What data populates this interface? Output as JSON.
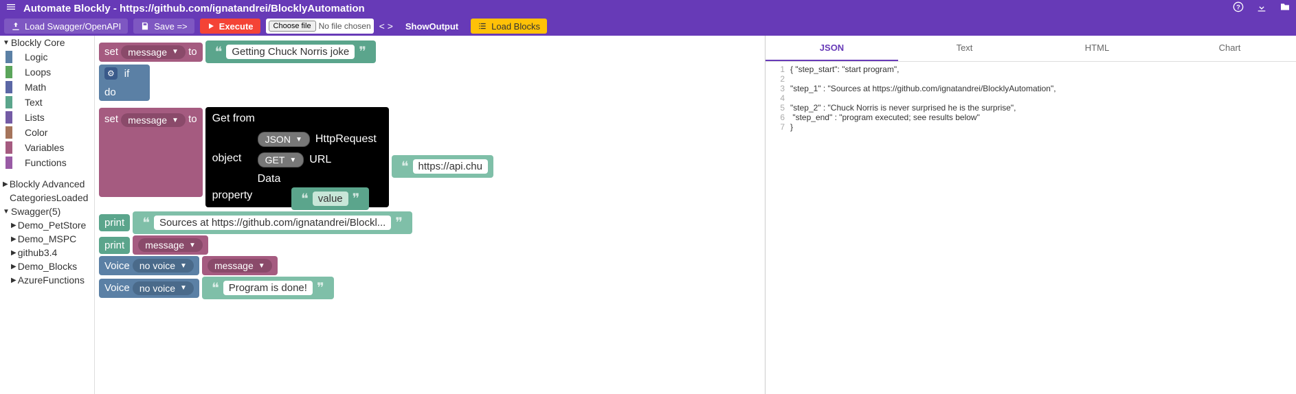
{
  "header": {
    "title": "Automate Blockly - https://github.com/ignatandrei/BlocklyAutomation"
  },
  "toolbar": {
    "load_swagger": "Load Swagger/OpenAPI",
    "save": "Save =>",
    "execute": "Execute",
    "choose_file": "Choose file",
    "no_file": "No file chosen",
    "show_output": "ShowOutput",
    "load_blocks": "Load Blocks"
  },
  "sidebar": {
    "core_label": "Blockly Core",
    "core": [
      {
        "label": "Logic",
        "color": "#5b80a5"
      },
      {
        "label": "Loops",
        "color": "#5ba55b"
      },
      {
        "label": "Math",
        "color": "#5b67a5"
      },
      {
        "label": "Text",
        "color": "#5ba58c"
      },
      {
        "label": "Lists",
        "color": "#745ba5"
      },
      {
        "label": "Color",
        "color": "#a5745b"
      },
      {
        "label": "Variables",
        "color": "#a55b80"
      },
      {
        "label": "Functions",
        "color": "#995ba5"
      }
    ],
    "advanced_label": "Blockly Advanced",
    "categories_label": "CategoriesLoaded",
    "swagger_label": "Swagger(5)",
    "swagger": [
      "Demo_PetStore",
      "Demo_MSPC",
      "github3.4",
      "Demo_Blocks",
      "AzureFunctions"
    ]
  },
  "blocks": {
    "set": "set",
    "to": "to",
    "message": "message",
    "if": "if",
    "do": "do",
    "text1": "Getting Chuck Norris joke",
    "getfrom": "Get from",
    "object": "object",
    "property": "property",
    "json": "JSON",
    "httpreq": "HttpRequest",
    "get": "GET",
    "url": "URL",
    "urlval": "https://api.chu",
    "data": "Data",
    "value": "value",
    "print": "print",
    "sources": "Sources at https://github.com/ignatandrei/Blockl...",
    "voice": "Voice",
    "novoice": "no voice",
    "done": "Program is done!"
  },
  "output": {
    "tabs": [
      "JSON",
      "Text",
      "HTML",
      "Chart"
    ],
    "lines": [
      "{ \"step_start\": \"start program\",",
      "",
      "\"step_1\" : \"Sources at https://github.com/ignatandrei/BlocklyAutomation\",",
      "",
      "\"step_2\" : \"Chuck Norris is never surprised he is the surprise\",",
      " \"step_end\" : \"program executed; see results below\"",
      "}"
    ]
  }
}
